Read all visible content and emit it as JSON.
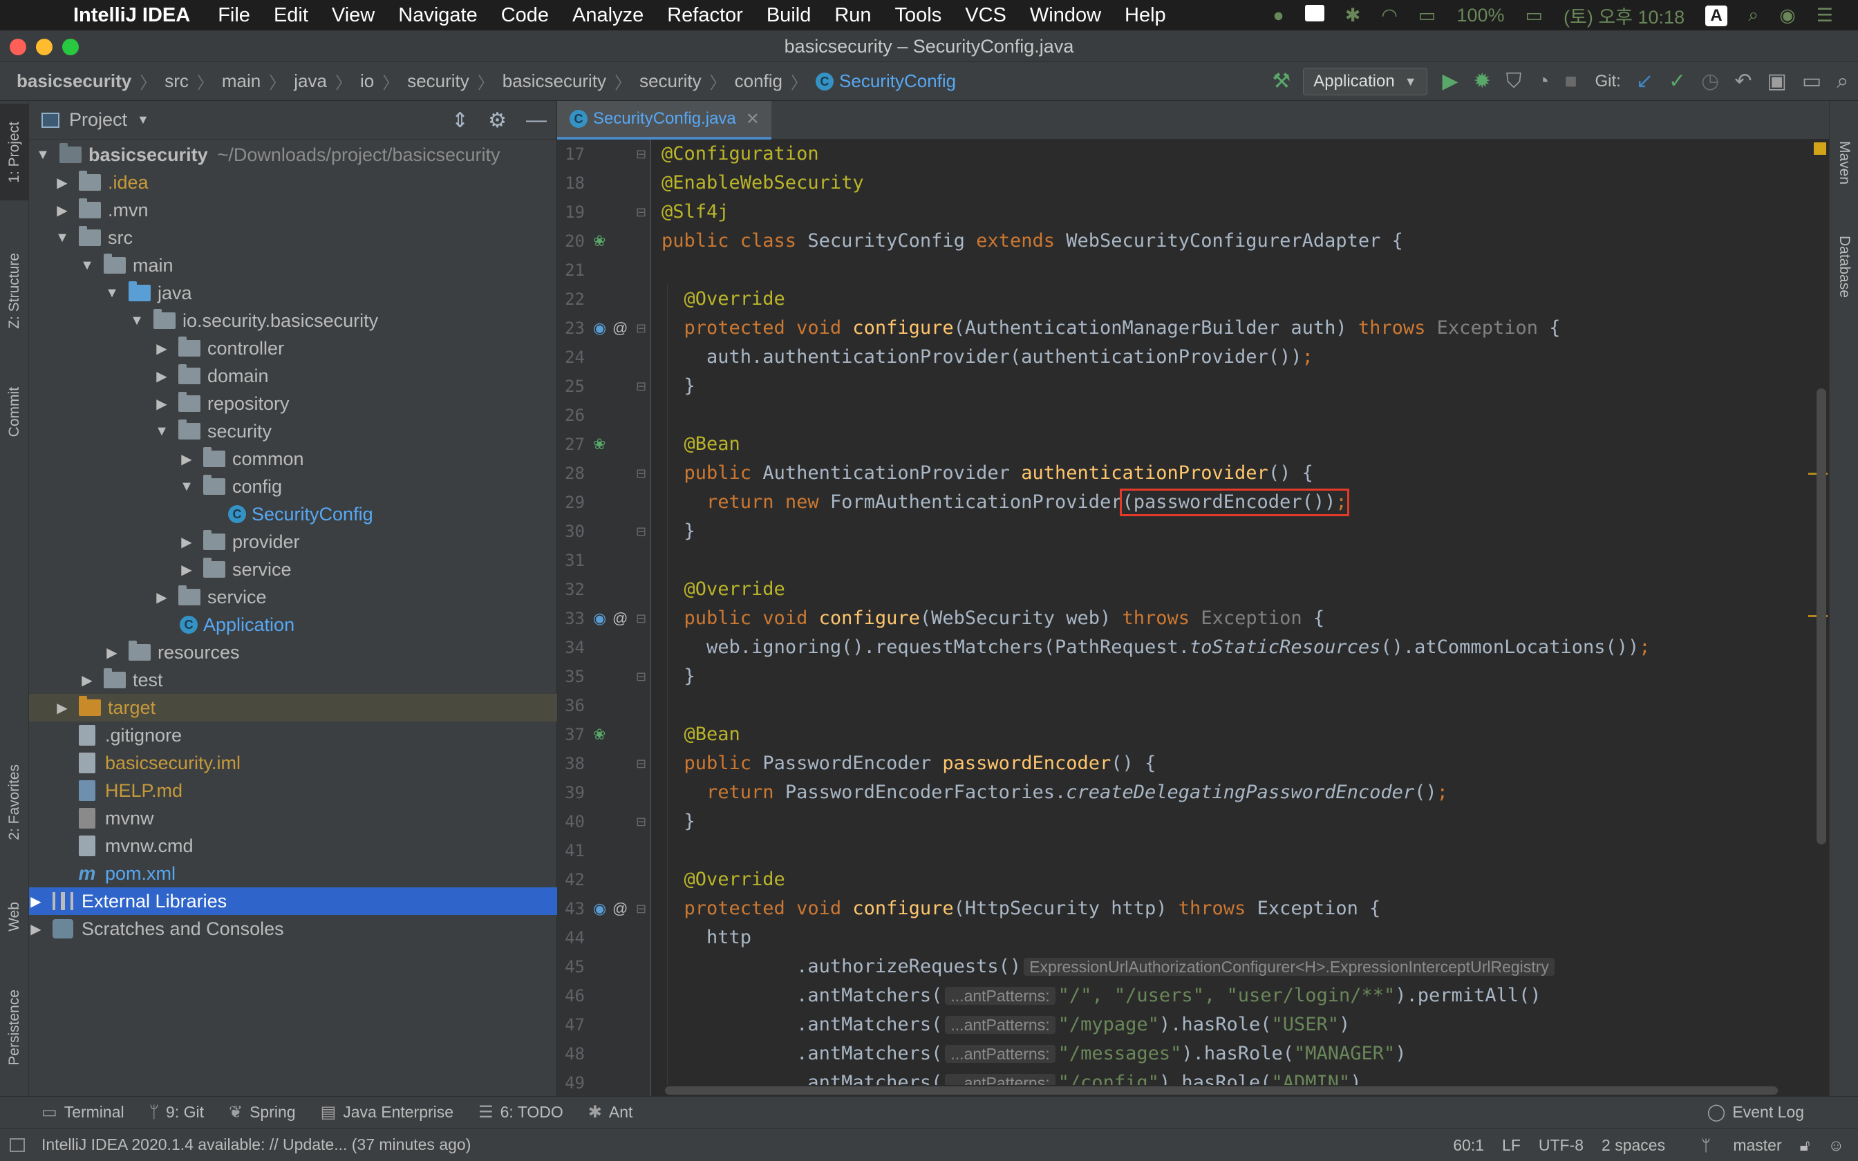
{
  "menubar": {
    "app_name": "IntelliJ IDEA",
    "items": [
      "File",
      "Edit",
      "View",
      "Navigate",
      "Code",
      "Analyze",
      "Refactor",
      "Build",
      "Run",
      "Tools",
      "VCS",
      "Window",
      "Help"
    ],
    "battery": "100%",
    "clock": "(토) 오후 10:18",
    "input_source": "A"
  },
  "window": {
    "title": "basicsecurity – SecurityConfig.java"
  },
  "breadcrumb": [
    "basicsecurity",
    "src",
    "main",
    "java",
    "io",
    "security",
    "basicsecurity",
    "security",
    "config",
    "SecurityConfig"
  ],
  "toolbar": {
    "run_config": "Application",
    "git_label": "Git:"
  },
  "left_strip": {
    "project": "1: Project",
    "structure": "Z: Structure",
    "commit": "Commit",
    "favorites": "2: Favorites",
    "web": "Web",
    "persistence": "Persistence"
  },
  "right_strip": {
    "maven": "Maven",
    "database": "Database"
  },
  "project_panel": {
    "title": "Project",
    "tree": [
      {
        "label": "basicsecurity",
        "hint": "~/Downloads/project/basicsecurity"
      },
      {
        "label": ".idea"
      },
      {
        "label": ".mvn"
      },
      {
        "label": "src"
      },
      {
        "label": "main"
      },
      {
        "label": "java"
      },
      {
        "label": "io.security.basicsecurity"
      },
      {
        "label": "controller"
      },
      {
        "label": "domain"
      },
      {
        "label": "repository"
      },
      {
        "label": "security"
      },
      {
        "label": "common"
      },
      {
        "label": "config"
      },
      {
        "label": "SecurityConfig"
      },
      {
        "label": "provider"
      },
      {
        "label": "service"
      },
      {
        "label": "service"
      },
      {
        "label": "Application"
      },
      {
        "label": "resources"
      },
      {
        "label": "test"
      },
      {
        "label": "target"
      },
      {
        "label": ".gitignore"
      },
      {
        "label": "basicsecurity.iml"
      },
      {
        "label": "HELP.md"
      },
      {
        "label": "mvnw"
      },
      {
        "label": "mvnw.cmd"
      },
      {
        "label": "pom.xml"
      },
      {
        "label": "External Libraries"
      },
      {
        "label": "Scratches and Consoles"
      }
    ]
  },
  "editor": {
    "tab": "SecurityConfig.java",
    "line_numbers": [
      "17",
      "18",
      "19",
      "20",
      "21",
      "22",
      "23",
      "24",
      "25",
      "26",
      "27",
      "28",
      "29",
      "30",
      "31",
      "32",
      "33",
      "34",
      "35",
      "36",
      "37",
      "38",
      "39",
      "40",
      "41",
      "42",
      "43",
      "44",
      "45",
      "46",
      "47",
      "48",
      "49"
    ],
    "code": {
      "l17": "@Configuration",
      "l18": "@EnableWebSecurity",
      "l19": "@Slf4j",
      "l20_kw": "public class ",
      "l20_name": "SecurityConfig ",
      "l20_ext": "extends ",
      "l20_rest": "WebSecurityConfigurerAdapter {",
      "l22": "@Override",
      "l23_kw": "protected void ",
      "l23_fn": "configure",
      "l23_args": "(AuthenticationManagerBuilder auth) ",
      "l23_throws": "throws ",
      "l23_exc": "Exception",
      "l23_end": " {",
      "l24": "auth.authenticationProvider(authenticationProvider())",
      "l24_semi": ";",
      "l25": "}",
      "l27": "@Bean",
      "l28_kw": "public ",
      "l28_type": "AuthenticationProvider ",
      "l28_fn": "authenticationProvider",
      "l28_end": "() {",
      "l29_kw": "return new ",
      "l29_cls": "FormAuthenticationProvider",
      "l29_box": "(passwordEncoder())",
      "l29_semi": ";",
      "l30": "}",
      "l32": "@Override",
      "l33_kw": "public void ",
      "l33_fn": "configure",
      "l33_args": "(WebSecurity web) ",
      "l33_throws": "throws ",
      "l33_exc": "Exception",
      "l33_end": " {",
      "l34_a": "web.ignoring().requestMatchers(PathRequest.",
      "l34_it": "toStaticResources",
      "l34_b": "().atCommonLocations())",
      "l34_semi": ";",
      "l35": "}",
      "l37": "@Bean",
      "l38_kw": "public ",
      "l38_type": "PasswordEncoder ",
      "l38_fn": "passwordEncoder",
      "l38_end": "() {",
      "l39_kw": "return ",
      "l39_a": "PasswordEncoderFactories.",
      "l39_it": "createDelegatingPasswordEncoder",
      "l39_b": "()",
      "l39_semi": ";",
      "l40": "}",
      "l42": "@Override",
      "l43_kw": "protected void ",
      "l43_fn": "configure",
      "l43_args": "(HttpSecurity http) ",
      "l43_throws": "throws ",
      "l43_exc": "Exception",
      "l43_end": " {",
      "l44": "http",
      "l45": ".authorizeRequests()",
      "l45_hint": "ExpressionUrlAuthorizationConfigurer<H>.ExpressionInterceptUrlRegistry",
      "inlay": "...antPatterns:",
      "l46_a": ".antMatchers(",
      "l46_s": "\"/\", \"/users\", \"user/login/**\"",
      "l46_b": ").permitAll()",
      "l47_a": ".antMatchers(",
      "l47_s": "\"/mypage\"",
      "l47_b": ").hasRole(",
      "l47_r": "\"USER\"",
      "l47_c": ")",
      "l48_a": ".antMatchers(",
      "l48_s": "\"/messages\"",
      "l48_b": ").hasRole(",
      "l48_r": "\"MANAGER\"",
      "l48_c": ")",
      "l49_a": ".antMatchers(",
      "l49_s": "\"/config\"",
      "l49_b": ").hasRole(",
      "l49_r": "\"ADMIN\"",
      "l49_c": ")"
    }
  },
  "bottom_tabs": {
    "terminal": "Terminal",
    "git": "9: Git",
    "spring": "Spring",
    "java_ee": "Java Enterprise",
    "todo": "6: TODO",
    "ant": "Ant",
    "event_log": "Event Log"
  },
  "status": {
    "message": "IntelliJ IDEA 2020.1.4 available: // Update... (37 minutes ago)",
    "position": "60:1",
    "line_sep": "LF",
    "encoding": "UTF-8",
    "indent": "2 spaces",
    "branch": "master"
  }
}
